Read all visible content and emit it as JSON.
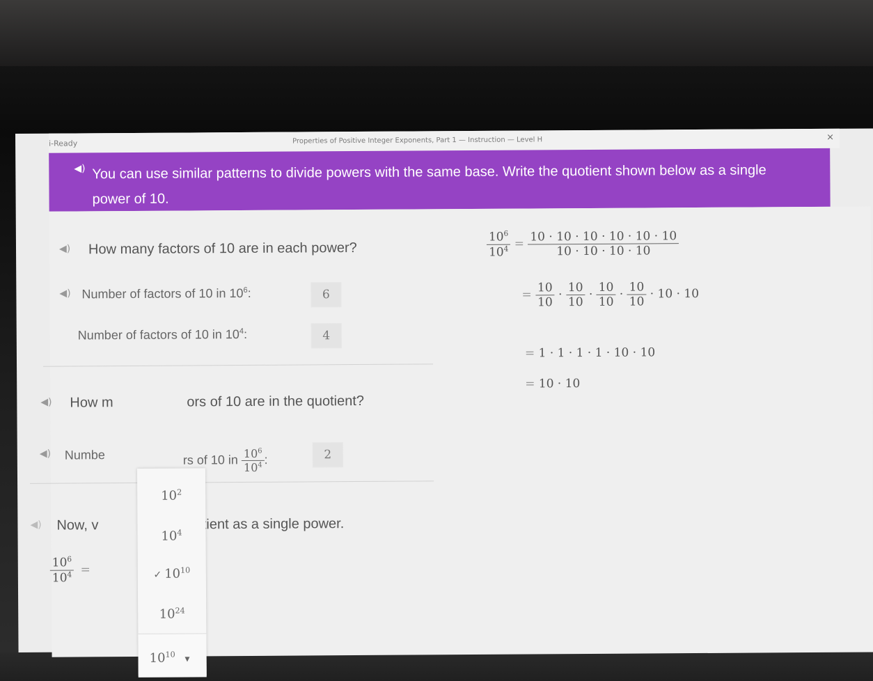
{
  "window": {
    "app_name": "i-Ready",
    "lesson_title": "Properties of Positive Integer Exponents, Part 1 — Instruction — Level H",
    "close_glyph": "×"
  },
  "banner": {
    "speaker_icon": "speaker-icon",
    "text": "You can use similar patterns to divide powers with the same base. Write the quotient shown below as a single power of 10."
  },
  "section1": {
    "question": "How many factors of 10 are in each power?",
    "row1": {
      "label": "Number of factors of 10 in 10",
      "exp": "6",
      "suffix": ":",
      "answer": "6"
    },
    "row2": {
      "label": "Number of factors of 10 in 10",
      "exp": "4",
      "suffix": ":",
      "answer": "4"
    }
  },
  "section2": {
    "question_left": "How m",
    "question_right": "ors of 10 are in the quotient?",
    "row_left": "Numbe",
    "row_right": "rs of 10 in",
    "frac_num": "10",
    "frac_num_exp": "6",
    "frac_den": "10",
    "frac_den_exp": "4",
    "suffix": ":",
    "answer": "2"
  },
  "section3": {
    "text_left": "Now, v",
    "text_right": "quotient as a single power.",
    "frac_num": "10",
    "frac_num_exp": "6",
    "frac_den": "10",
    "frac_den_exp": "4",
    "equals": "="
  },
  "dropdown": {
    "options": [
      {
        "base": "10",
        "exp": "2",
        "check": ""
      },
      {
        "base": "10",
        "exp": "4",
        "check": ""
      },
      {
        "base": "10",
        "exp": "10",
        "check": "✓"
      },
      {
        "base": "10",
        "exp": "24",
        "check": ""
      }
    ],
    "selected_base": "10",
    "selected_exp": "10",
    "arrow": "▾"
  },
  "work": {
    "lhs_num": "10",
    "lhs_num_exp": "6",
    "lhs_den": "10",
    "lhs_den_exp": "4",
    "eq": "=",
    "step1_num": "10 · 10 · 10 · 10 · 10 · 10",
    "step1_den": "10 · 10 · 10 · 10",
    "step2_frac_num": "10",
    "step2_frac_den": "10",
    "step2_dot": "·",
    "step2_tail": "· 10 · 10",
    "step3": "1 · 1 · 1 · 1 · 10 · 10",
    "step4": "10 · 10"
  }
}
